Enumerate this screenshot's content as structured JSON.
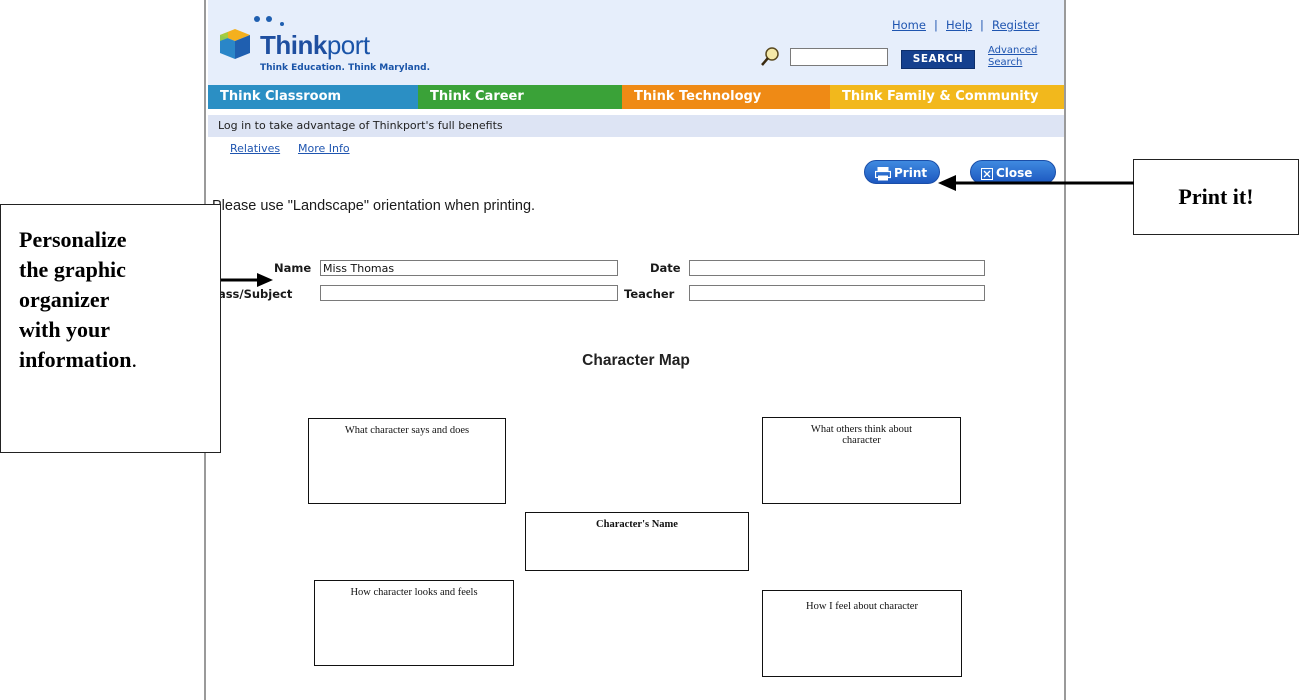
{
  "header": {
    "logo_name_bold": "Think",
    "logo_name_rest": "port",
    "logo_tagline": "Think Education. Think Maryland.",
    "top_links": [
      "Home",
      "Help",
      "Register"
    ],
    "separator": "|",
    "search_button": "SEARCH",
    "advanced_search_line1": "Advanced",
    "advanced_search_line2": "Search"
  },
  "nav": {
    "tabs": [
      {
        "label": "Think Classroom",
        "color": "#2b8fc4"
      },
      {
        "label": "Think Career",
        "color": "#3aa238"
      },
      {
        "label": "Think Technology",
        "color": "#ef8a15"
      },
      {
        "label": "Think Family & Community",
        "color": "#f2b81c"
      }
    ]
  },
  "login_bar": {
    "text": "Log in to take advantage of Thinkport's full benefits",
    "links": [
      "Relatives",
      "More Info"
    ]
  },
  "actions": {
    "print_label": "Print",
    "close_label": "Close"
  },
  "orientation_note": "Please use \"Landscape\" orientation when printing.",
  "form": {
    "name_label": "Name",
    "name_value": "Miss Thomas",
    "date_label": "Date",
    "date_value": "",
    "class_label": "lass/Subject",
    "class_value": "",
    "teacher_label": "Teacher",
    "teacher_value": ""
  },
  "character_map": {
    "title": "Character Map",
    "boxes": {
      "says_does": "What character says and does",
      "others_think": "What others think about character",
      "name": "Character's Name",
      "looks_feels": "How character looks and feels",
      "i_feel": "How I feel about character"
    }
  },
  "callouts": {
    "print_it": "Print it!",
    "personalize_lines": [
      "Personalize",
      "the graphic",
      "organizer",
      "with your",
      "information"
    ],
    "personalize_period": "."
  }
}
